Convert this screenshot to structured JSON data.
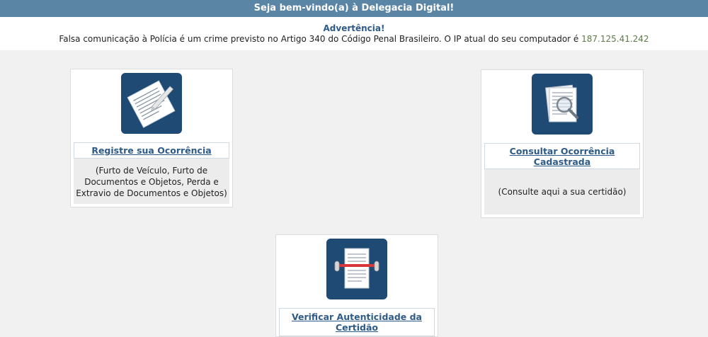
{
  "header": {
    "welcome": "Seja bem-vindo(a) à Delegacia Digital!"
  },
  "warning": {
    "title": "Advertência!",
    "text": "Falsa comunicação à Polícia é um crime previsto no Artigo 340 do Código Penal Brasileiro. O IP atual do seu computador é",
    "ip": "187.125.41.242"
  },
  "cards": {
    "register": {
      "icon": "document-pen-icon",
      "link": "Registre sua Ocorrência",
      "description": "(Furto de Veículo, Furto de Documentos e Objetos, Perda e Extravio de Documentos e Objetos)"
    },
    "consult": {
      "icon": "document-magnifier-icon",
      "link": "Consultar Ocorrência Cadastrada",
      "description": "(Consulte aqui a sua certidão)"
    },
    "verify": {
      "icon": "document-scanner-icon",
      "link": "Verificar Autenticidade da Certidão"
    }
  },
  "colors": {
    "header_bg": "#5b85a5",
    "icon_bg": "#1f4a73",
    "link": "#2d5a88"
  }
}
